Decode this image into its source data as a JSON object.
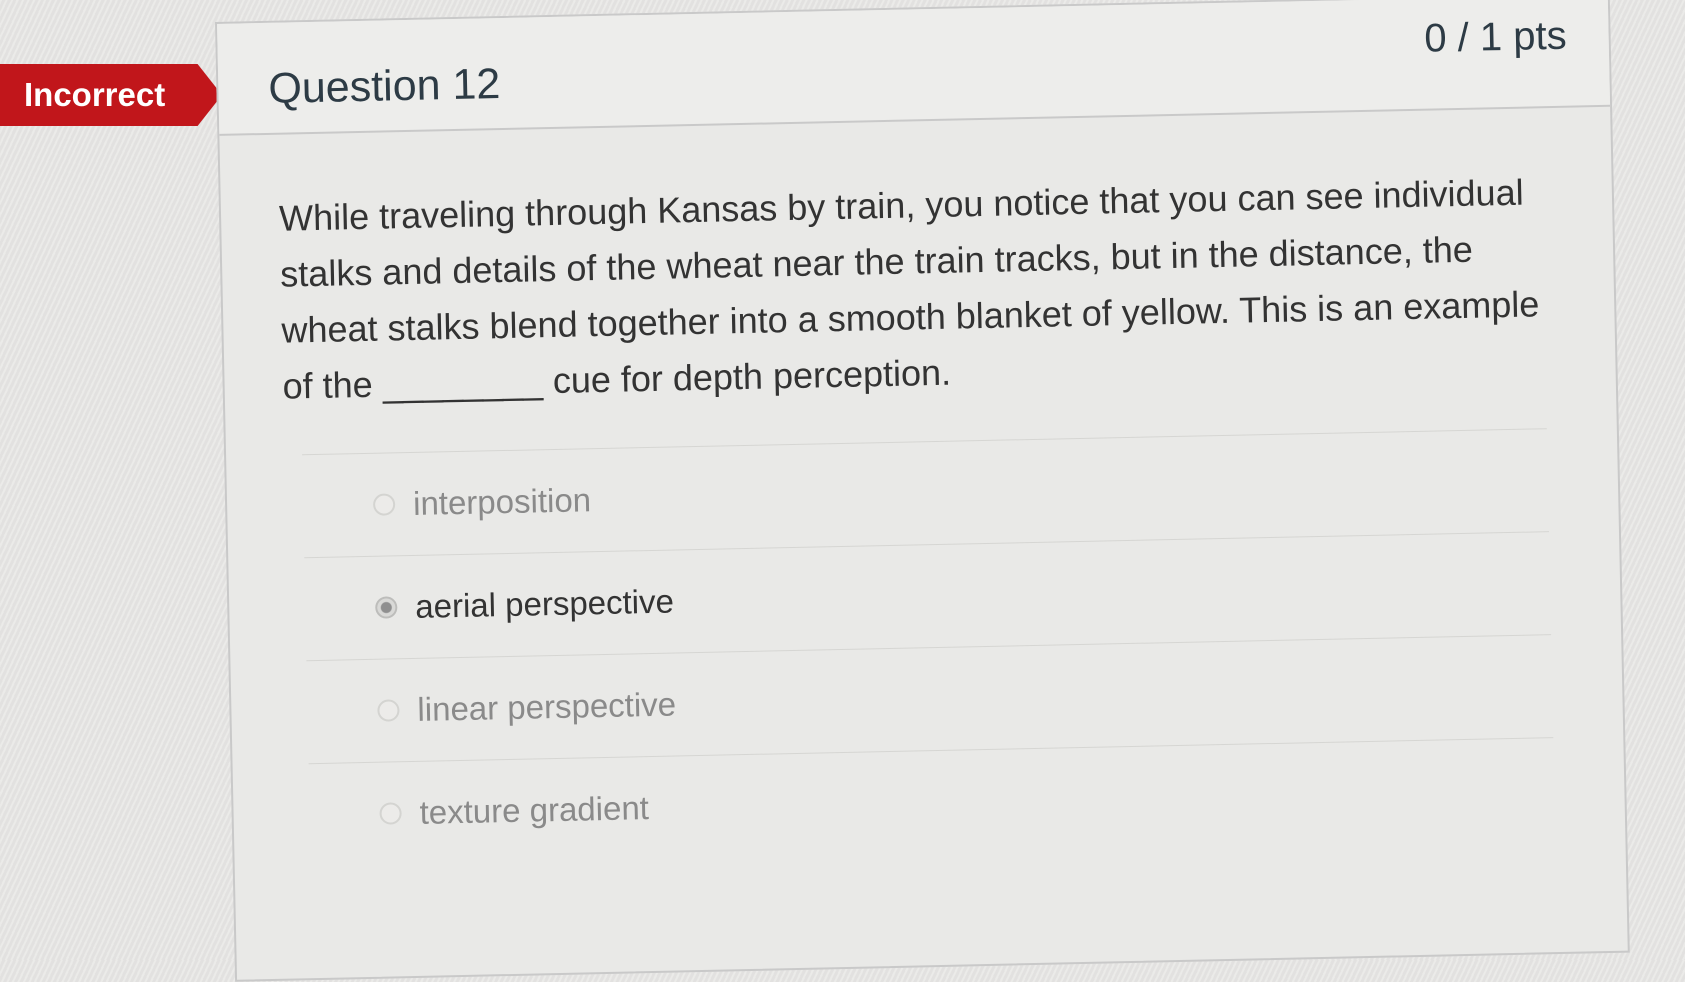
{
  "status_badge": "Incorrect",
  "question": {
    "title": "Question 12",
    "points": "0 / 1 pts",
    "text": "While traveling through Kansas by train, you notice that you can see individual stalks and details of the wheat near the train tracks, but in the distance, the wheat stalks blend together into a smooth blanket of yellow. This is an example of the ________ cue for depth perception."
  },
  "answers": [
    {
      "label": "interposition",
      "selected": false
    },
    {
      "label": "aerial perspective",
      "selected": true
    },
    {
      "label": "linear perspective",
      "selected": false
    },
    {
      "label": "texture gradient",
      "selected": false
    }
  ],
  "colors": {
    "incorrect_badge": "#c1161b",
    "text": "#333333",
    "muted_text": "#8a8a8a",
    "border": "#c9c9c9"
  }
}
